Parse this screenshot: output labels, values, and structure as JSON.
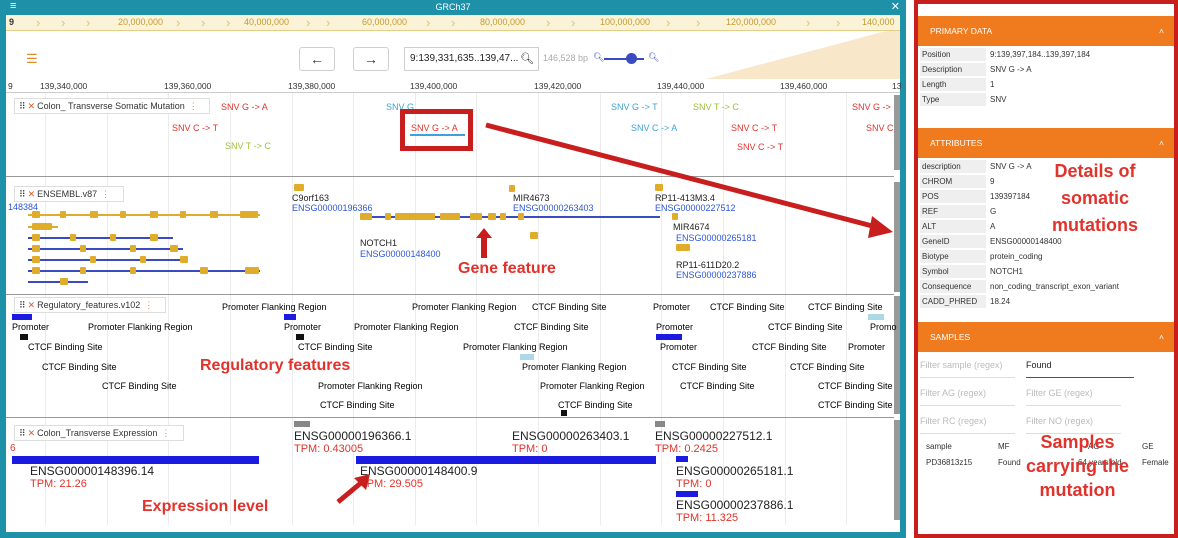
{
  "app": {
    "title": "GRCh37",
    "menu_icon": "hamburger-icon",
    "close_icon": "close-icon"
  },
  "ruler": {
    "labels": [
      "9",
      "20,000,000",
      "40,000,000",
      "60,000,000",
      "80,000,000",
      "100,000,000",
      "120,000,000",
      "140,000"
    ]
  },
  "nav": {
    "back": "←",
    "forward": "→",
    "location": "9:139,331,635..139,47...",
    "bp_info": "146,528 bp"
  },
  "coords": [
    "9",
    "139,340,000",
    "139,360,000",
    "139,380,000",
    "139,400,000",
    "139,420,000",
    "139,440,000",
    "139,460,000",
    "13"
  ],
  "tracks": {
    "somatic": {
      "name": "Colon_ Transverse Somatic Mutation",
      "mutations": [
        "SNV G -> A",
        "SNV C -> T",
        "SNV T -> C",
        "SNV G",
        "SNV G -> A",
        "SNV G -> T",
        "SNV T -> C",
        "SNV C -> A",
        "SNV C -> T",
        "SNV C -> T",
        "SNV G ->",
        "SNV C"
      ]
    },
    "ensembl": {
      "name": "ENSEMBL.v87",
      "genes": [
        "148384",
        "C9orf163",
        "ENSG00000196366",
        "MIR4673",
        "ENSG00000263403",
        "RP11-413M3.4",
        "ENSG00000227512",
        "MIR4674",
        "ENSG00000265181",
        "RP11-611D20.2",
        "ENSG00000237886",
        "NOTCH1",
        "ENSG00000148400"
      ]
    },
    "regulatory": {
      "name": "Regulatory_features.v102",
      "labels": [
        "Promoter Flanking Region",
        "Promoter Flanking Region",
        "CTCF Binding Site",
        "Promoter",
        "CTCF Binding Site",
        "CTCF Binding Site",
        "Promoter",
        "Promoter Flanking Region",
        "Promoter",
        "Promoter Flanking Region",
        "CTCF Binding Site",
        "Promoter",
        "CTCF Binding Site",
        "Promo",
        "CTCF Binding Site",
        "CTCF Binding Site",
        "Promoter Flanking Region",
        "Promoter",
        "CTCF Binding Site",
        "Promoter",
        "CTCF Binding Site",
        "Promoter Flanking Region",
        "CTCF Binding Site",
        "CTCF Binding Site",
        "CTCF Binding Site",
        "CTCF Binding Site",
        "Promoter Flanking Region",
        "Promoter Flanking Region",
        "CTCF Binding Site",
        "CTCF Binding Site",
        "CTCF Binding Site",
        "CTCF Binding Site",
        "CTCF Binding Site"
      ]
    },
    "expression": {
      "name": "Colon_Transverse Expression",
      "items": [
        {
          "id": "ENSG00000196366.1",
          "tpm": "TPM: 0.43005"
        },
        {
          "id": "ENSG00000263403.1",
          "tpm": "TPM: 0"
        },
        {
          "id": "ENSG00000227512.1",
          "tpm": "TPM: 0.2425"
        },
        {
          "id": "ENSG00000148396.14",
          "tpm": "TPM: 21.26"
        },
        {
          "id": "ENSG00000148400.9",
          "tpm": "TPM: 29.505"
        },
        {
          "id": "ENSG00000265181.1",
          "tpm": "TPM: 0"
        },
        {
          "id": "ENSG00000237886.1",
          "tpm": "TPM: 11.325"
        }
      ],
      "left_mark": "6"
    }
  },
  "annotations": {
    "gene_feature": "Gene feature",
    "regulatory": "Regulatory features",
    "expression": "Expression level",
    "details": "Details of\nsomatic\nmutations",
    "samples": "Samples\ncarrying the\nmutation"
  },
  "panel": {
    "primary": {
      "title": "PRIMARY DATA",
      "rows": [
        [
          "Position",
          "9:139,397,184..139,397,184"
        ],
        [
          "Description",
          "SNV G -> A"
        ],
        [
          "Length",
          "1"
        ],
        [
          "Type",
          "SNV"
        ]
      ]
    },
    "attributes": {
      "title": "ATTRIBUTES",
      "rows": [
        [
          "description",
          "SNV G -> A"
        ],
        [
          "CHROM",
          "9"
        ],
        [
          "POS",
          "139397184"
        ],
        [
          "REF",
          "G"
        ],
        [
          "ALT",
          "A"
        ],
        [
          "GeneID",
          "ENSG00000148400"
        ],
        [
          "Biotype",
          "protein_coding"
        ],
        [
          "Symbol",
          "NOTCH1"
        ],
        [
          "Consequence",
          "non_coding_transcript_exon_variant"
        ],
        [
          "CADD_PHRED",
          "18.24"
        ]
      ]
    },
    "samples": {
      "title": "SAMPLES",
      "filters": {
        "sample": "Filter sample (regex)",
        "mf_value": "Found",
        "ag": "Filter AG (regex)",
        "ge": "Filter GE (regex)",
        "rc": "Filter RC (regex)",
        "no": "Filter NO (regex)"
      },
      "columns": [
        "sample",
        "MF",
        "AG",
        "GE"
      ],
      "row": [
        "PD36813z15",
        "Found",
        "64 years old",
        "Female"
      ]
    }
  },
  "colors": {
    "teal": "#1e90a8",
    "orange": "#f07b1f",
    "red": "#c81e1e",
    "gene": "#e0ac2c",
    "expr": "#1a1ae0"
  }
}
